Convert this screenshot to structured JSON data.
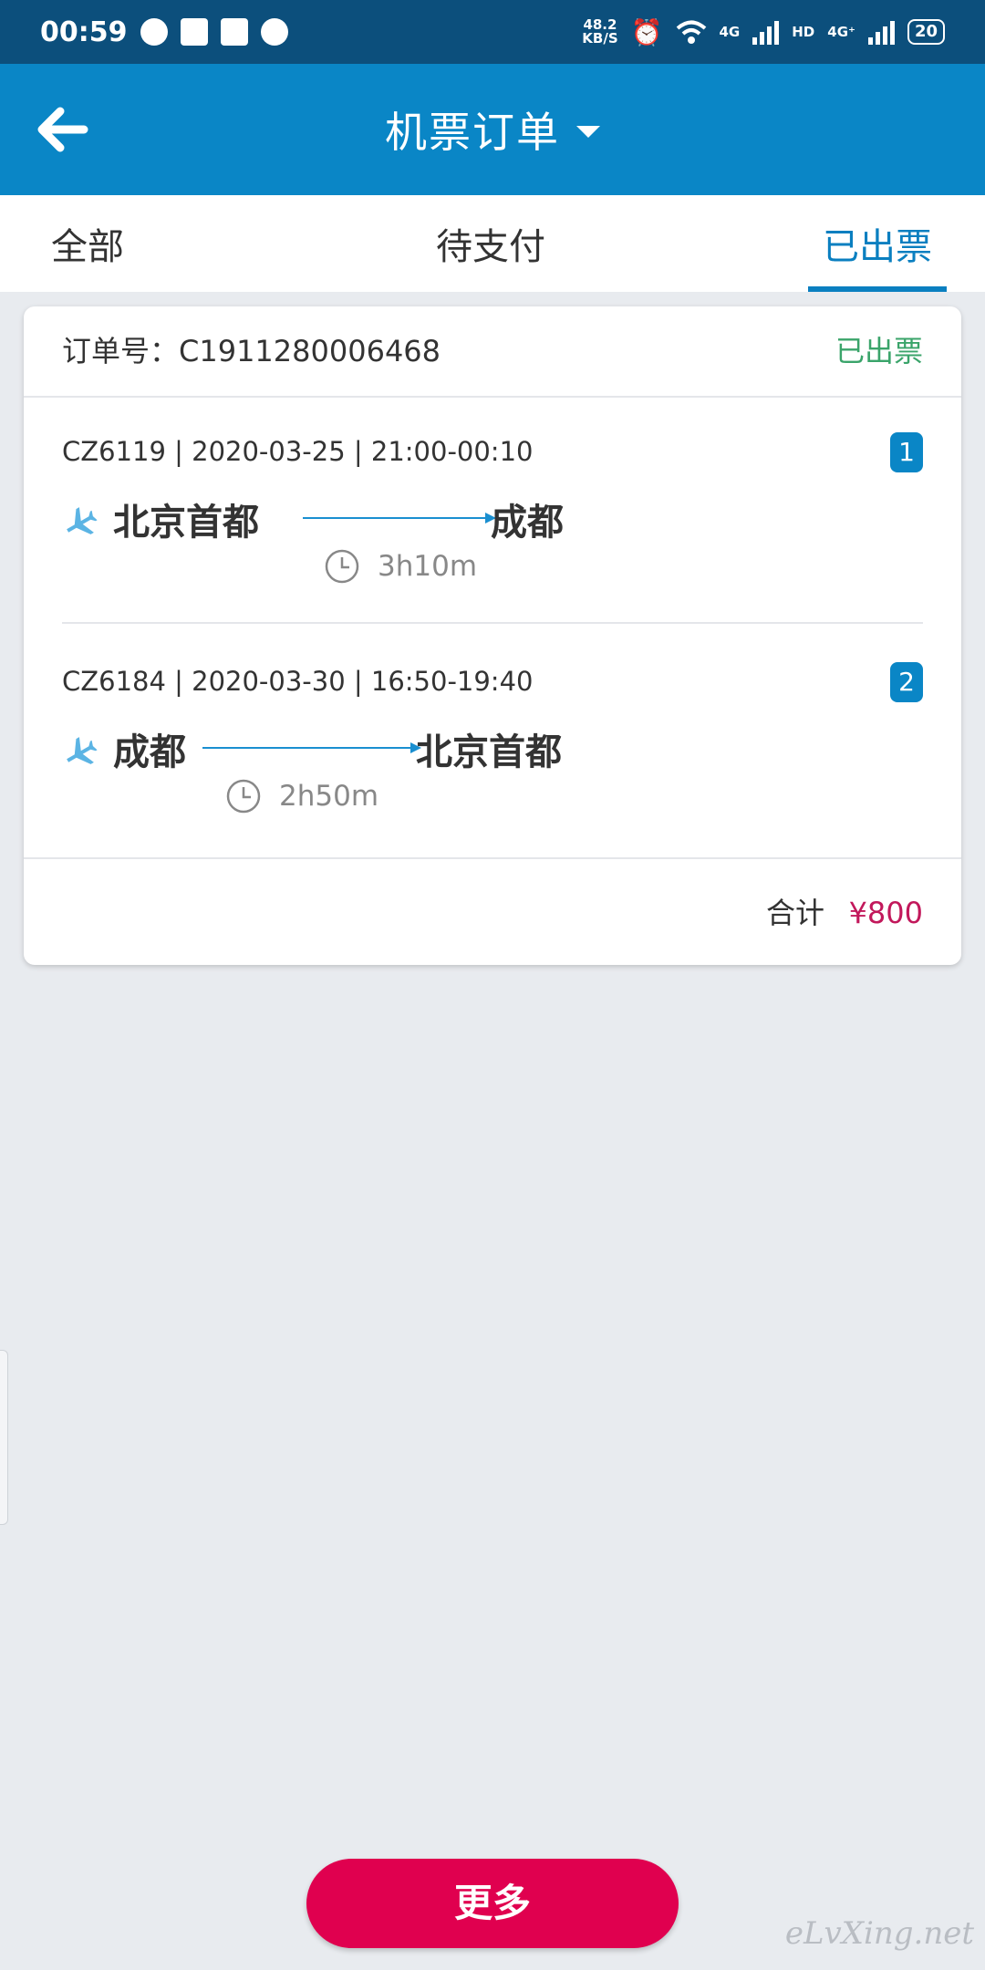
{
  "status_bar": {
    "time": "00:59",
    "net_speed": "48.2",
    "net_speed_unit": "KB/S",
    "network_1": "4G",
    "network_hd": "HD",
    "network_2": "4G⁺",
    "battery": "20"
  },
  "header": {
    "title": "机票订单",
    "back_icon": "arrow-left-icon",
    "dropdown_icon": "caret-down-icon"
  },
  "tabs": [
    {
      "label": "全部",
      "active": false
    },
    {
      "label": "待支付",
      "active": false
    },
    {
      "label": "已出票",
      "active": true
    }
  ],
  "order": {
    "order_number_label": "订单号：C1911280006468",
    "status": "已出票",
    "legs": [
      {
        "number": "1",
        "info": "CZ6119 | 2020-03-25 | 21:00-00:10",
        "from": "北京首都",
        "to": "成都",
        "duration": "3h10m"
      },
      {
        "number": "2",
        "info": "CZ6184 | 2020-03-30 | 16:50-19:40",
        "from": "成都",
        "to": "北京首都",
        "duration": "2h50m"
      }
    ],
    "total_label": "合计",
    "total_value": "¥800"
  },
  "more_button": "更多",
  "watermark": "eLvXing.net",
  "colors": {
    "status_bar": "#0c4f7c",
    "header": "#0a86c6",
    "tab_active": "#0a7fc0",
    "ticketed_green": "#3aa46a",
    "price": "#c2185b",
    "more_button": "#e0004f"
  }
}
